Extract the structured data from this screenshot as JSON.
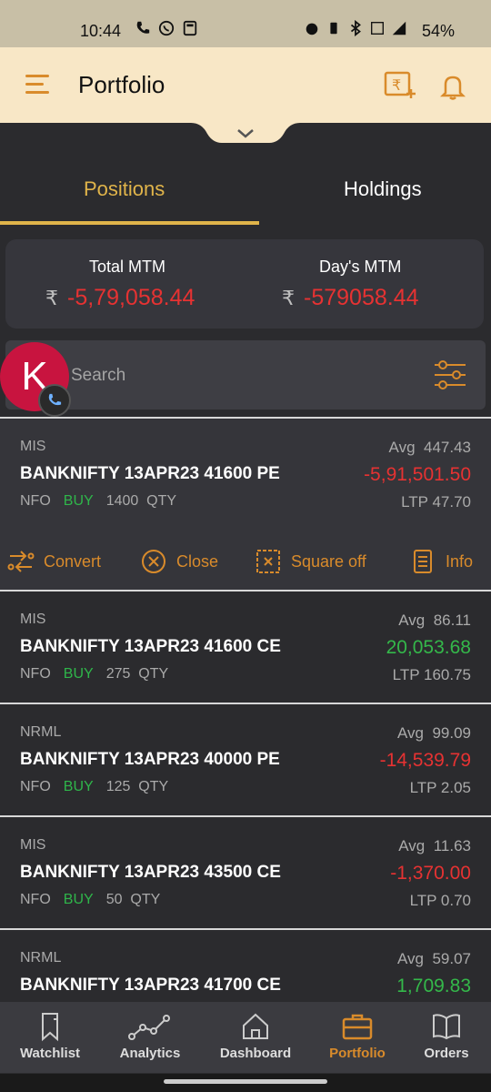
{
  "status_bar": {
    "time": "10:44",
    "battery": "54%",
    "network": "4G"
  },
  "header": {
    "title": "Portfolio"
  },
  "tabs": [
    {
      "label": "Positions",
      "active": true
    },
    {
      "label": "Holdings",
      "active": false
    }
  ],
  "mtm": {
    "total_label": "Total MTM",
    "total_value": "-5,79,058.44",
    "day_label": "Day's MTM",
    "day_value": "-579058.44",
    "currency": "₹"
  },
  "search": {
    "placeholder": "Search"
  },
  "avatar": {
    "initial": "K"
  },
  "positions": [
    {
      "product": "MIS",
      "symbol": "BANKNIFTY 13APR23 41600 PE",
      "exchange": "NFO",
      "side": "BUY",
      "qty": "1400",
      "qty_label": "QTY",
      "avg_label": "Avg",
      "avg": "447.43",
      "pnl": "-5,91,501.50",
      "ltp_label": "LTP",
      "ltp": "47.70"
    },
    {
      "product": "MIS",
      "symbol": "BANKNIFTY 13APR23 41600 CE",
      "exchange": "NFO",
      "side": "BUY",
      "qty": "275",
      "qty_label": "QTY",
      "avg_label": "Avg",
      "avg": "86.11",
      "pnl": "20,053.68",
      "ltp_label": "LTP",
      "ltp": "160.75"
    },
    {
      "product": "NRML",
      "symbol": "BANKNIFTY 13APR23 40000 PE",
      "exchange": "NFO",
      "side": "BUY",
      "qty": "125",
      "qty_label": "QTY",
      "avg_label": "Avg",
      "avg": "99.09",
      "pnl": "-14,539.79",
      "ltp_label": "LTP",
      "ltp": "2.05"
    },
    {
      "product": "MIS",
      "symbol": "BANKNIFTY 13APR23 43500 CE",
      "exchange": "NFO",
      "side": "BUY",
      "qty": "50",
      "qty_label": "QTY",
      "avg_label": "Avg",
      "avg": "11.63",
      "pnl": "-1,370.00",
      "ltp_label": "LTP",
      "ltp": "0.70"
    },
    {
      "product": "NRML",
      "symbol": "BANKNIFTY 13APR23 41700 CE",
      "exchange": "",
      "side": "",
      "qty": "",
      "qty_label": "",
      "avg_label": "Avg",
      "avg": "59.07",
      "pnl": "1,709.83",
      "ltp_label": "",
      "ltp": ""
    }
  ],
  "position_actions": {
    "convert": "Convert",
    "close": "Close",
    "square_off": "Square off",
    "info": "Info"
  },
  "bottom_nav": [
    {
      "label": "Watchlist",
      "icon": "bookmark-icon"
    },
    {
      "label": "Analytics",
      "icon": "analytics-icon"
    },
    {
      "label": "Dashboard",
      "icon": "home-icon"
    },
    {
      "label": "Portfolio",
      "icon": "briefcase-icon",
      "active": true
    },
    {
      "label": "Orders",
      "icon": "book-icon"
    }
  ],
  "colors": {
    "accent": "#e0b44a",
    "loss": "#e63232",
    "profit": "#34b84a",
    "header_bg": "#f8e7c6",
    "body_bg": "#2b2b2e"
  }
}
